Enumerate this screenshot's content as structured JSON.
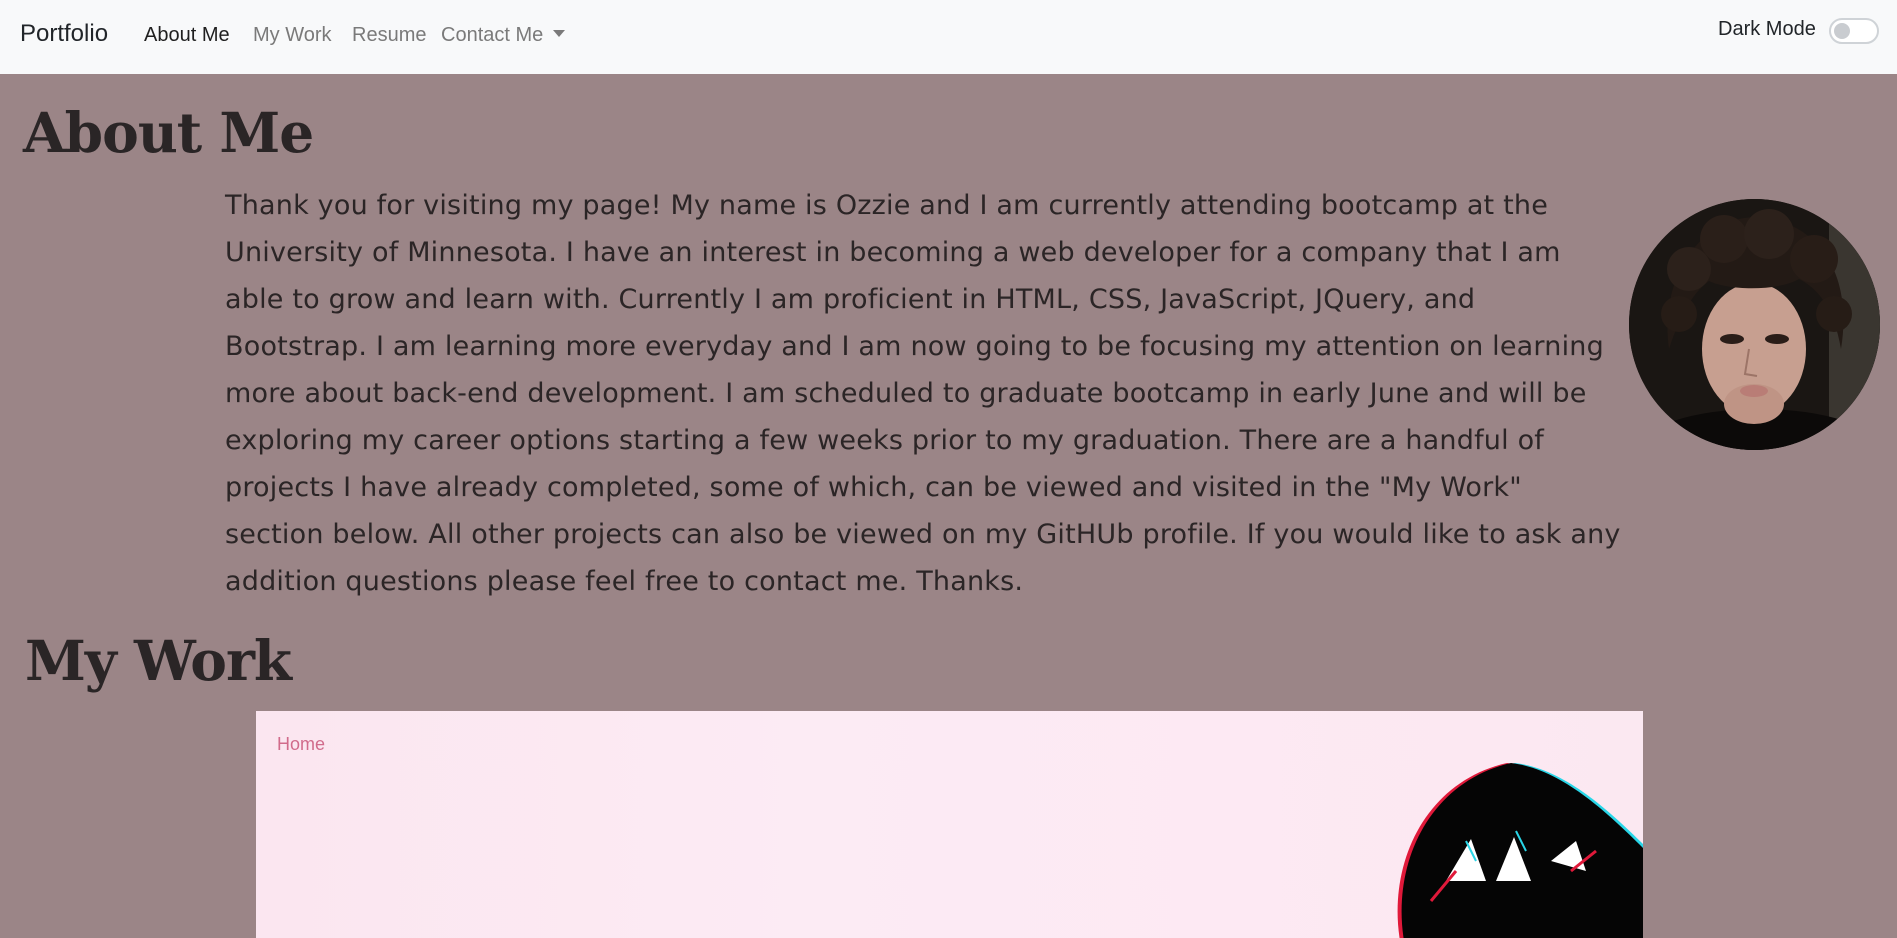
{
  "navbar": {
    "brand": "Portfolio",
    "links": [
      "About Me",
      "My Work",
      "Resume",
      "Contact Me"
    ],
    "dark_mode_label": "Dark Mode",
    "dark_mode_on": false
  },
  "about": {
    "heading": "About Me",
    "body": "Thank you for visiting my page! My name is Ozzie and I am currently attending bootcamp at the University of Minnesota. I have an interest in becoming a web developer for a company that I am able to grow and learn with. Currently I am proficient in HTML, CSS, JavaScript, JQuery, and Bootstrap. I am learning more everyday and I am now going to be focusing my attention on learning more about back-end development. I am scheduled to graduate bootcamp in early June and will be exploring my career options starting a few weeks prior to my graduation. There are a handful of projects I have already completed, some of which, can be viewed and visited in the \"My Work\" section below. All other projects can also be viewed on my GitHUb profile. If you would like to ask any addition questions please feel free to contact me. Thanks."
  },
  "work": {
    "heading": "My Work",
    "project_nav_link": "Home"
  },
  "colors": {
    "page_bg": "#9b8587",
    "navbar_bg": "#f8f9fa",
    "project_bg": "#fce8f2",
    "project_link": "#d16b8b"
  }
}
